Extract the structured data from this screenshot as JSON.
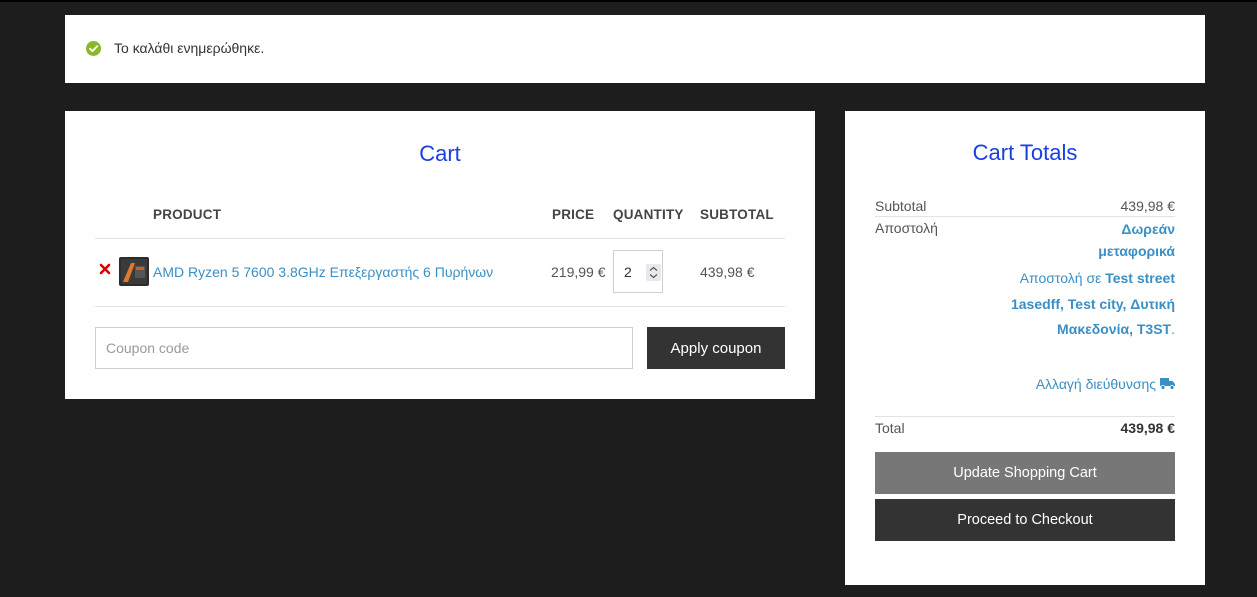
{
  "notice": {
    "message": "Το καλάθι ενημερώθηκε.",
    "icon": "check-circle-icon",
    "color": "#8bb829"
  },
  "cart": {
    "title": "Cart",
    "columns": {
      "product": "PRODUCT",
      "price": "PRICE",
      "quantity": "QUANTITY",
      "subtotal": "SUBTOTAL"
    },
    "items": [
      {
        "name": "AMD Ryzen 5 7600 3.8GHz Επεξεργαστής 6 Πυρήνων",
        "price": "219,99 €",
        "quantity": "2",
        "subtotal": "439,98 €"
      }
    ],
    "coupon": {
      "placeholder": "Coupon code",
      "button": "Apply coupon"
    }
  },
  "totals": {
    "title": "Cart Totals",
    "subtotal_label": "Subtotal",
    "subtotal_value": "439,98 €",
    "shipping_label": "Αποστολή",
    "shipping_method": "Δωρεάν μεταφορικά",
    "shipping_to_prefix": "Αποστολή σε",
    "shipping_address": "Test street 1asedff, Test city, Δυτική Μακεδονία, T3ST",
    "shipping_to_suffix": ".",
    "change_address": "Αλλαγή διεύθυνσης",
    "total_label": "Total",
    "total_value": "439,98 €",
    "update_button": "Update Shopping Cart",
    "checkout_button": "Proceed to Checkout"
  },
  "colors": {
    "accent_title": "#1a3ee0",
    "link": "#3a8fc4",
    "remove": "#e00000",
    "dark_button": "#333333",
    "grey_button": "#777777"
  }
}
